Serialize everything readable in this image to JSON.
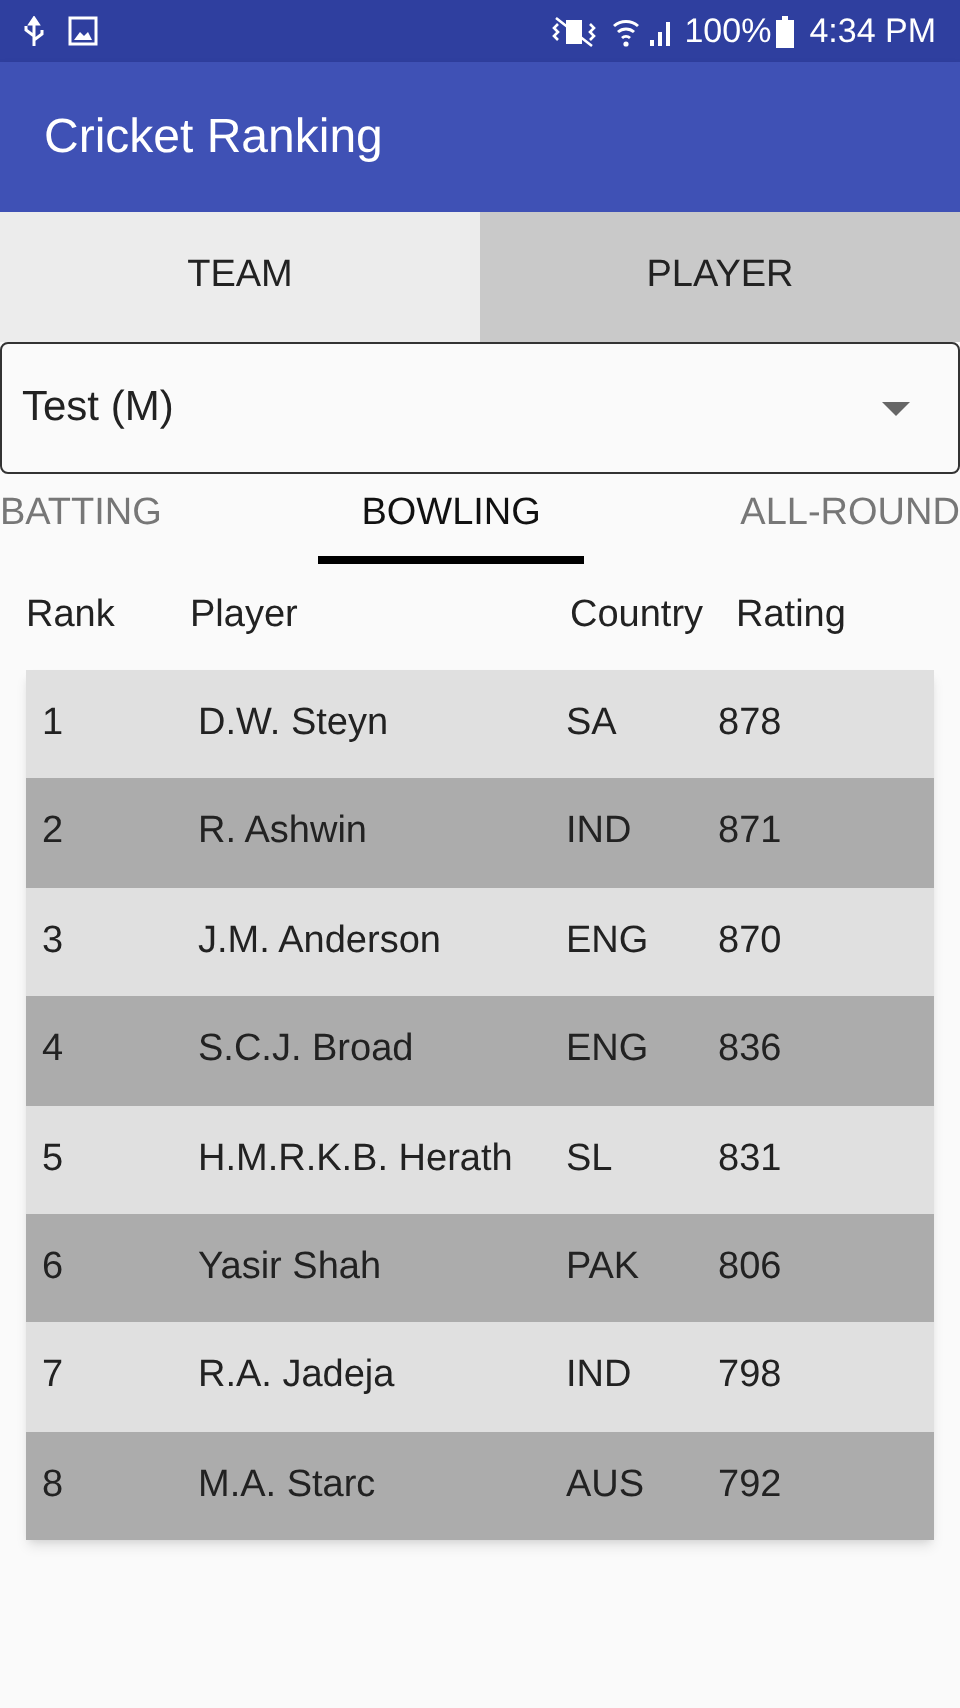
{
  "status_bar": {
    "battery": "100%",
    "time": "4:34 PM"
  },
  "app_bar": {
    "title": "Cricket Ranking"
  },
  "tabs": [
    {
      "label": "TEAM",
      "selected": true
    },
    {
      "label": "PLAYER",
      "selected": false
    }
  ],
  "format_dropdown": {
    "value": "Test (M)"
  },
  "category_tabs": [
    {
      "label": "BATTING",
      "selected": false
    },
    {
      "label": "BOWLING",
      "selected": true
    },
    {
      "label": "ALL-ROUND",
      "selected": false
    }
  ],
  "table": {
    "columns": [
      "Rank",
      "Player",
      "Country",
      "Rating"
    ],
    "rows": [
      [
        "1",
        "D.W. Steyn",
        "SA",
        "878"
      ],
      [
        "2",
        "R. Ashwin",
        "IND",
        "871"
      ],
      [
        "3",
        "J.M. Anderson",
        "ENG",
        "870"
      ],
      [
        "4",
        "S.C.J. Broad",
        "ENG",
        "836"
      ],
      [
        "5",
        "H.M.R.K.B. Herath",
        "SL",
        "831"
      ],
      [
        "6",
        "Yasir Shah",
        "PAK",
        "806"
      ],
      [
        "7",
        "R.A. Jadeja",
        "IND",
        "798"
      ],
      [
        "8",
        "M.A. Starc",
        "AUS",
        "792"
      ]
    ]
  }
}
